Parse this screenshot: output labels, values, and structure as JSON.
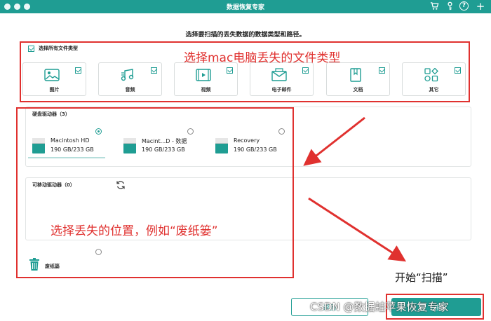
{
  "window": {
    "title": "数据恢复专家"
  },
  "header_icons": [
    "cart-icon",
    "key-icon",
    "help-icon",
    "plus-icon"
  ],
  "instruction": "选择要扫描的丢失数据的数据类型和路径。",
  "file_types": {
    "select_all_label": "选择所有文件类型",
    "select_all_checked": true,
    "items": [
      {
        "label": "图片",
        "icon": "image-icon",
        "checked": true
      },
      {
        "label": "音频",
        "icon": "music-icon",
        "checked": true
      },
      {
        "label": "视频",
        "icon": "video-icon",
        "checked": true
      },
      {
        "label": "电子邮件",
        "icon": "email-icon",
        "checked": true
      },
      {
        "label": "文档",
        "icon": "document-icon",
        "checked": true
      },
      {
        "label": "其它",
        "icon": "other-icon",
        "checked": true
      }
    ]
  },
  "hard_drives": {
    "title": "硬盘驱动器（3）",
    "items": [
      {
        "name": "Macintosh HD",
        "size": "190 GB/233 GB",
        "selected": true
      },
      {
        "name": "Macint...D - 数据",
        "size": "190 GB/233 GB",
        "selected": false
      },
      {
        "name": "Recovery",
        "size": "190 GB/233 GB",
        "selected": false
      }
    ]
  },
  "removable_drives": {
    "title": "可移动驱动器（0）"
  },
  "trash": {
    "label": "废纸篓",
    "selected": false
  },
  "buttons": {
    "back": "返回",
    "scan": "扫描"
  },
  "annotations": {
    "file_type_note": "选择mac电脑丢失的文件类型",
    "location_note": "选择丢失的位置，例如“废纸篓”",
    "start_scan_note": "开始“扫描”"
  },
  "watermark": "CSDN @数据蛙苹果恢复专家",
  "colors": {
    "accent": "#1f9d93",
    "annotation": "#e0312f"
  }
}
